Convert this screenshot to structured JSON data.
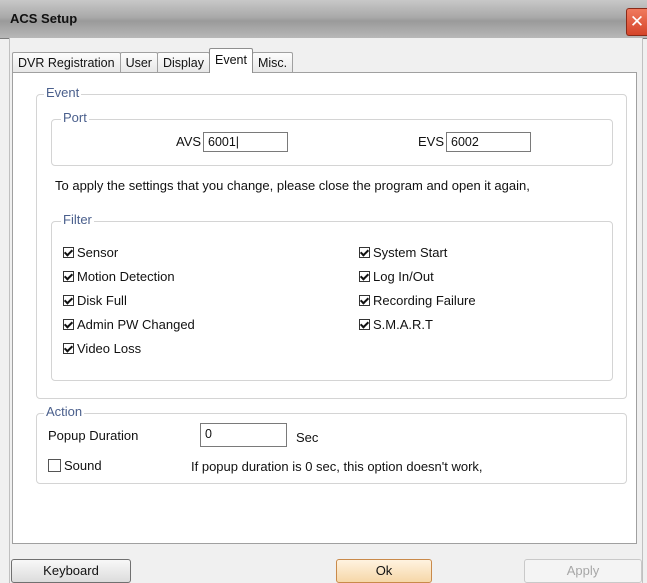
{
  "window": {
    "title": "ACS Setup",
    "close_glyph": "✕"
  },
  "tabs": [
    {
      "label": "DVR Registration"
    },
    {
      "label": "User"
    },
    {
      "label": "Display"
    },
    {
      "label": "Event"
    },
    {
      "label": "Misc."
    }
  ],
  "event": {
    "legend": "Event",
    "port": {
      "legend": "Port",
      "avs_label": "AVS",
      "avs_value": "6001|",
      "evs_label": "EVS",
      "evs_value": "6002"
    },
    "notice": "To apply the settings that you change, please close the program and open it again,"
  },
  "filter": {
    "legend": "Filter",
    "left": [
      {
        "label": "Sensor",
        "checked": true
      },
      {
        "label": "Motion Detection",
        "checked": true
      },
      {
        "label": "Disk Full",
        "checked": true
      },
      {
        "label": "Admin PW Changed",
        "checked": true
      },
      {
        "label": "Video Loss",
        "checked": true
      }
    ],
    "right": [
      {
        "label": "System Start",
        "checked": true
      },
      {
        "label": "Log In/Out",
        "checked": true
      },
      {
        "label": "Recording Failure",
        "checked": true
      },
      {
        "label": "S.M.A.R.T",
        "checked": true
      }
    ]
  },
  "action": {
    "legend": "Action",
    "popup_label": "Popup Duration",
    "popup_value": "0",
    "popup_unit": "Sec",
    "sound_label": "Sound",
    "sound_checked": false,
    "sound_note": "If popup duration is 0 sec, this option doesn't work,"
  },
  "buttons": {
    "keyboard": "Keyboard",
    "ok": "Ok",
    "apply": "Apply"
  }
}
